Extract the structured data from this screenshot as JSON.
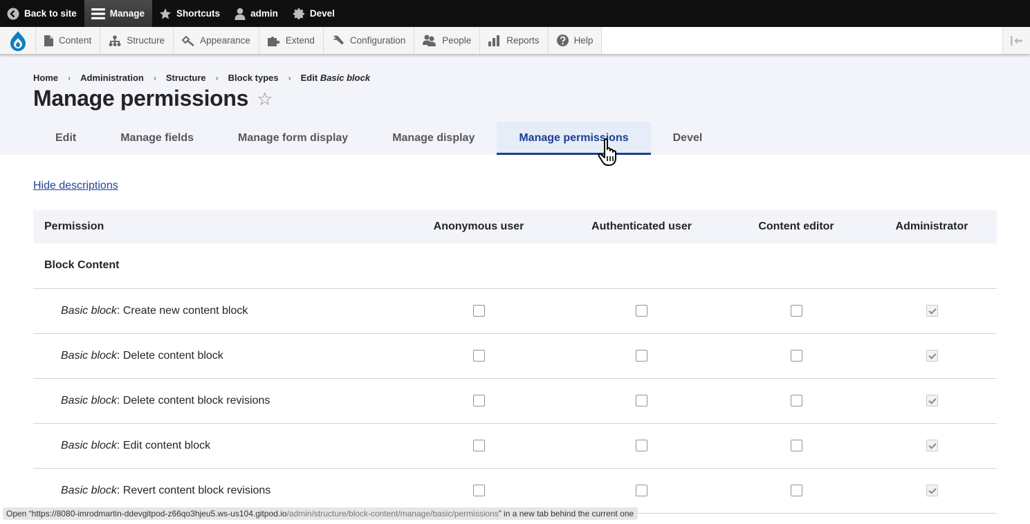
{
  "toolbar": {
    "items": [
      {
        "label": "Back to site",
        "icon": "back-arrow-circle-icon"
      },
      {
        "label": "Manage",
        "icon": "hamburger-icon",
        "active": true
      },
      {
        "label": "Shortcuts",
        "icon": "star-icon"
      },
      {
        "label": "admin",
        "icon": "user-icon"
      },
      {
        "label": "Devel",
        "icon": "gear-icon"
      }
    ]
  },
  "tray": {
    "logo": "drupal-logo-icon",
    "items": [
      {
        "label": "Content",
        "icon": "file-icon"
      },
      {
        "label": "Structure",
        "icon": "sitemap-icon"
      },
      {
        "label": "Appearance",
        "icon": "paintbrush-icon"
      },
      {
        "label": "Extend",
        "icon": "puzzle-icon"
      },
      {
        "label": "Configuration",
        "icon": "wrench-icon"
      },
      {
        "label": "People",
        "icon": "people-icon"
      },
      {
        "label": "Reports",
        "icon": "bar-chart-icon"
      },
      {
        "label": "Help",
        "icon": "help-icon"
      }
    ],
    "collapse_icon": "collapse-left-icon"
  },
  "breadcrumb": {
    "items": [
      "Home",
      "Administration",
      "Structure",
      "Block types"
    ],
    "last_prefix": "Edit ",
    "last_emphasis": "Basic block",
    "separator": "›"
  },
  "page": {
    "title": "Manage permissions",
    "star": "☆"
  },
  "tabs": [
    {
      "label": "Edit"
    },
    {
      "label": "Manage fields"
    },
    {
      "label": "Manage form display"
    },
    {
      "label": "Manage display"
    },
    {
      "label": "Manage permissions",
      "active": true
    },
    {
      "label": "Devel"
    }
  ],
  "content": {
    "hide_descriptions": "Hide descriptions",
    "table": {
      "headers": [
        "Permission",
        "Anonymous user",
        "Authenticated user",
        "Content editor",
        "Administrator"
      ],
      "module": "Block Content",
      "rows": [
        {
          "prefix": "Basic block",
          "text": ": Create new content block",
          "checks": [
            false,
            false,
            false,
            true
          ]
        },
        {
          "prefix": "Basic block",
          "text": ": Delete content block",
          "checks": [
            false,
            false,
            false,
            true
          ]
        },
        {
          "prefix": "Basic block",
          "text": ": Delete content block revisions",
          "checks": [
            false,
            false,
            false,
            true
          ]
        },
        {
          "prefix": "Basic block",
          "text": ": Edit content block",
          "checks": [
            false,
            false,
            false,
            true
          ]
        },
        {
          "prefix": "Basic block",
          "text": ": Revert content block revisions",
          "checks": [
            false,
            false,
            false,
            true
          ]
        }
      ]
    }
  },
  "status_bar": {
    "prefix": "Open “https://8080-imrodmartin-ddevgitpod-z66qo3hjeu5.ws-us104.gitpod.io",
    "path": "/admin/structure/block-content/manage/basic/permissions",
    "suffix": "” in a new tab behind the current one"
  }
}
